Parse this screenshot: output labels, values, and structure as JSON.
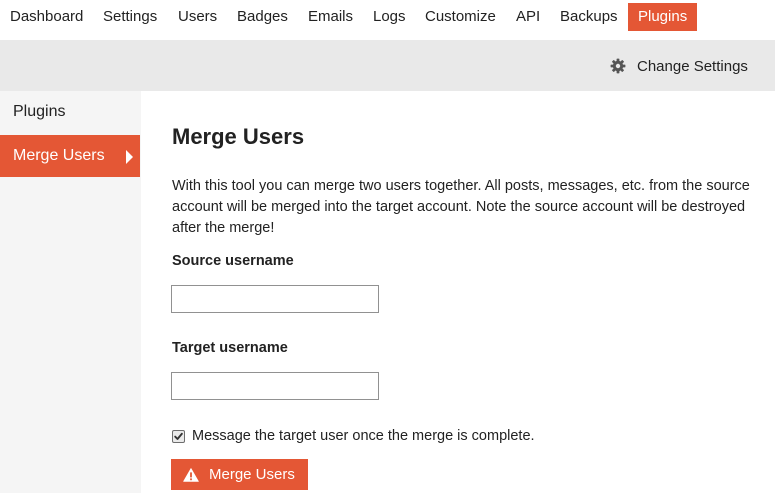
{
  "nav": {
    "items": [
      {
        "label": "Dashboard"
      },
      {
        "label": "Settings"
      },
      {
        "label": "Users"
      },
      {
        "label": "Badges"
      },
      {
        "label": "Emails"
      },
      {
        "label": "Logs"
      },
      {
        "label": "Customize"
      },
      {
        "label": "API"
      },
      {
        "label": "Backups"
      },
      {
        "label": "Plugins",
        "active": true
      }
    ]
  },
  "subheader": {
    "change_settings_label": "Change Settings",
    "change_settings_icon": "gear-icon"
  },
  "sidebar": {
    "heading": "Plugins",
    "active_item": "Merge Users",
    "active_item_icon": "caret-right-icon"
  },
  "main": {
    "title": "Merge Users",
    "description": "With this tool you can merge two users together. All posts, messages, etc. from the source account will be merged into the target account. Note the source account will be destroyed after the merge!",
    "source_label": "Source username",
    "source_value": "",
    "target_label": "Target username",
    "target_value": "",
    "notify_checkbox_label": "Message the target user once the merge is complete.",
    "notify_checked": true,
    "merge_button_label": "Merge Users",
    "merge_button_icon": "warning-icon"
  },
  "colors": {
    "accent": "#e45735",
    "subheader_bg": "#e9e9e9",
    "sidebar_bg": "#f5f5f5",
    "text": "#222222"
  }
}
